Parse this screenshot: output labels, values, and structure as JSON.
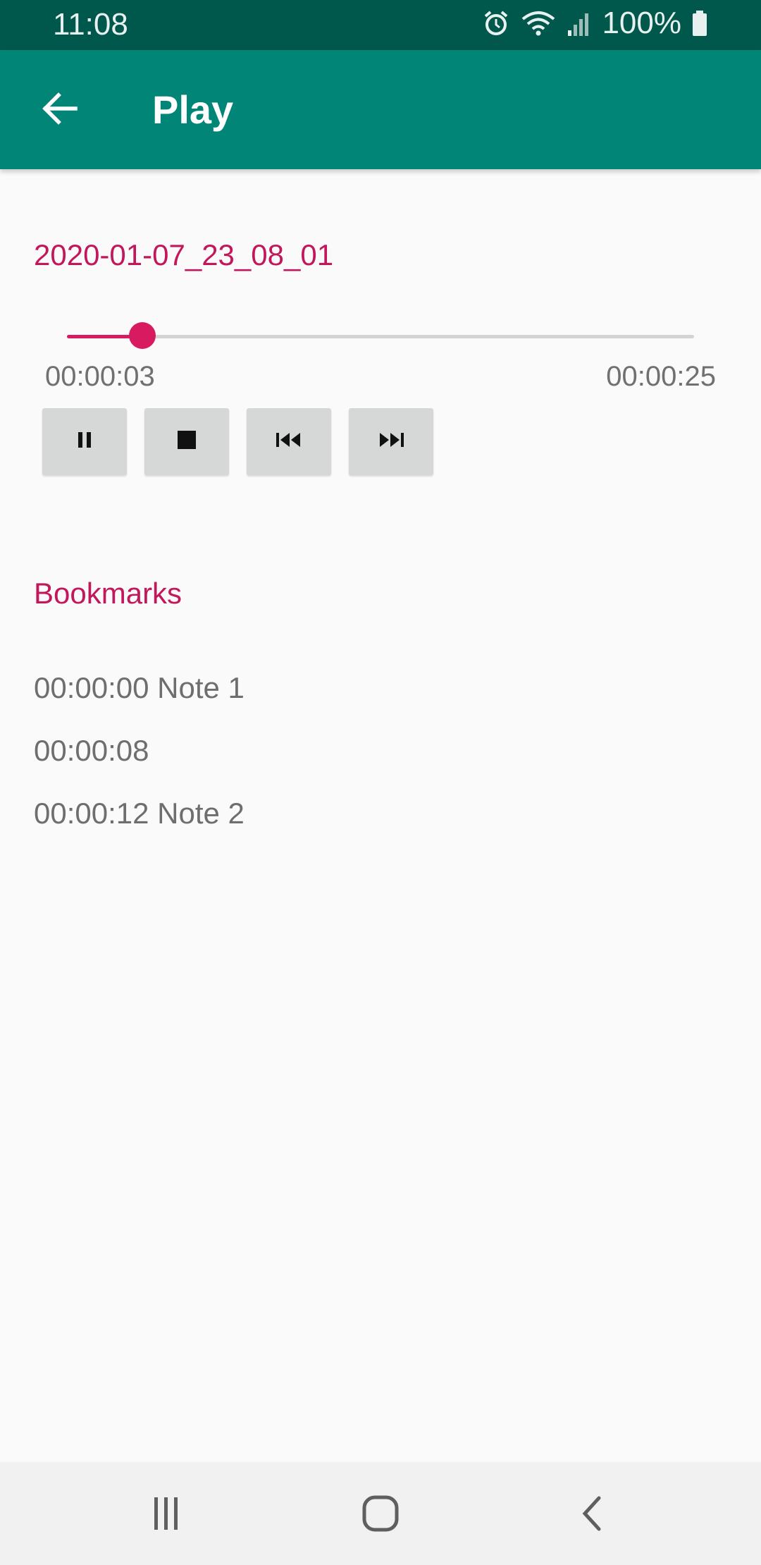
{
  "status_bar": {
    "time": "11:08",
    "battery": "100%",
    "icons": [
      "alarm-icon",
      "wifi-icon",
      "signal-icon",
      "battery-icon"
    ]
  },
  "app_bar": {
    "title": "Play",
    "back_icon": "arrow-left-icon",
    "background": "#008577"
  },
  "player": {
    "file_name": "2020-01-07_23_08_01",
    "current_time": "00:00:03",
    "total_time": "00:00:25",
    "progress_fraction": 0.12,
    "accent": "#d81b60",
    "controls": [
      {
        "name": "pause-button",
        "icon": "pause-icon"
      },
      {
        "name": "stop-button",
        "icon": "stop-icon"
      },
      {
        "name": "previous-button",
        "icon": "skip-previous-icon"
      },
      {
        "name": "next-button",
        "icon": "skip-next-icon"
      }
    ]
  },
  "bookmarks": {
    "header": "Bookmarks",
    "items": [
      {
        "label": "00:00:00 Note 1"
      },
      {
        "label": "00:00:08"
      },
      {
        "label": "00:00:12 Note 2"
      }
    ]
  },
  "nav_bar": {
    "buttons": [
      "recent-apps-icon",
      "home-icon",
      "back-icon"
    ]
  }
}
